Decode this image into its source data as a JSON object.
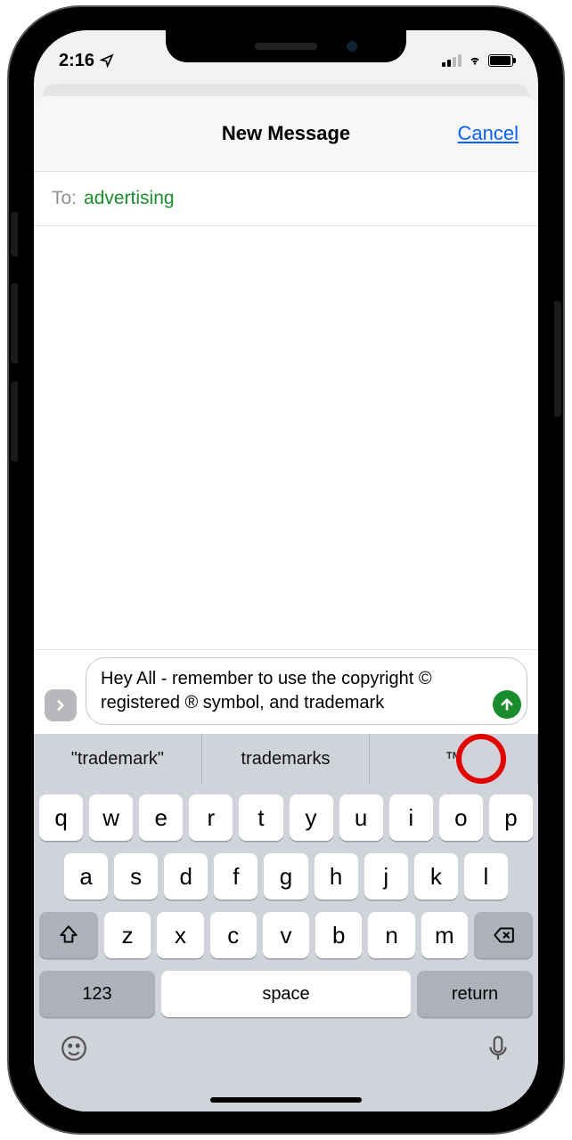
{
  "status": {
    "time": "2:16",
    "location_icon": "location"
  },
  "nav": {
    "title": "New Message",
    "cancel": "Cancel"
  },
  "to": {
    "label": "To:",
    "value": "advertising"
  },
  "message": {
    "text": "Hey All - remember to use the copyright © registered ® symbol, and trademark"
  },
  "suggestions": [
    "\"trademark\"",
    "trademarks",
    "™"
  ],
  "keyboard": {
    "row1": [
      "q",
      "w",
      "e",
      "r",
      "t",
      "y",
      "u",
      "i",
      "o",
      "p"
    ],
    "row2": [
      "a",
      "s",
      "d",
      "f",
      "g",
      "h",
      "j",
      "k",
      "l"
    ],
    "row3": [
      "z",
      "x",
      "c",
      "v",
      "b",
      "n",
      "m"
    ],
    "numeric": "123",
    "space": "space",
    "return": "return"
  },
  "colors": {
    "accent_green": "#1a8c2e",
    "ios_blue": "#0b60ff",
    "annotation_red": "#e30000"
  }
}
